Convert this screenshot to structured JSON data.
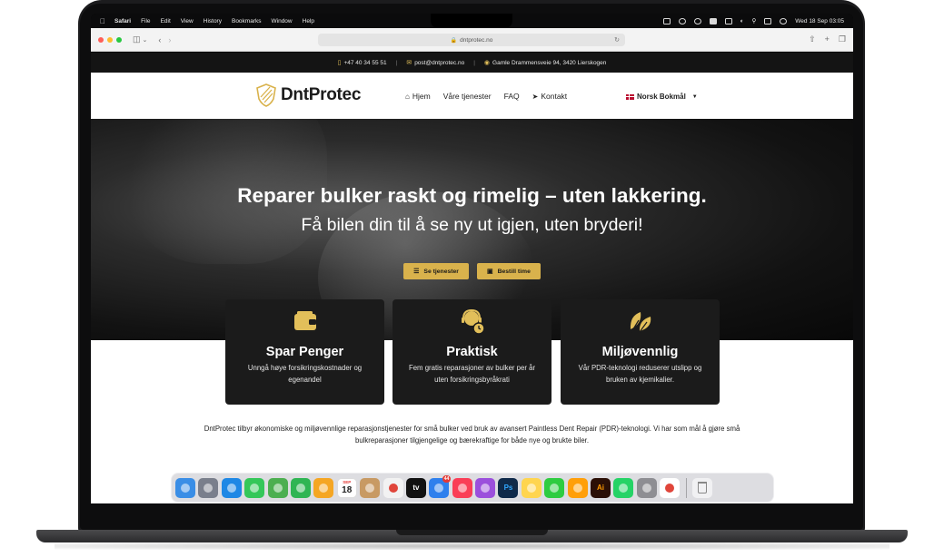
{
  "menubar": {
    "app": "Safari",
    "items": [
      "File",
      "Edit",
      "View",
      "History",
      "Bookmarks",
      "Window",
      "Help"
    ],
    "clock": "Wed 18 Sep  03:05"
  },
  "browser": {
    "url": "dntprotec.no"
  },
  "infobar": {
    "phone": "+47 40 34 55 51",
    "email": "post@dntprotec.no",
    "address": "Gamle Drammensveie 94, 3420 Lierskogen"
  },
  "nav": {
    "logo": "DntProtec",
    "items": [
      "Hjem",
      "Våre tjenester",
      "FAQ",
      "Kontakt"
    ],
    "language": "Norsk Bokmål"
  },
  "hero": {
    "title": "Reparer bulker raskt og rimelig – uten lakkering.",
    "subtitle": "Få bilen din til å se ny ut igjen, uten bryderi!",
    "btn_services": "Se tjenester",
    "btn_book": "Bestill time"
  },
  "cards": [
    {
      "title": "Spar Penger",
      "text": "Unngå høye forsikringskostnader og egenandel",
      "icon": "wallet-icon"
    },
    {
      "title": "Praktisk",
      "text": "Fem gratis reparasjoner av bulker per år uten forsikringsbyråkrati",
      "icon": "support-agent-icon"
    },
    {
      "title": "Miljøvennlig",
      "text": "Vår PDR-teknologi reduserer utslipp og bruken av kjemikalier.",
      "icon": "leaves-icon"
    }
  ],
  "intro": "DntProtec tilbyr økonomiske og miljøvennlige reparasjonstjenester for små bulker ved bruk av avansert Paintless Dent Repair (PDR)-teknologi. Vi har som mål å gjøre små bulkreparasjoner tilgjengelige og bærekraftige for både nye og brukte biler.",
  "dock": {
    "calendar_month": "SEP",
    "calendar_day": "18",
    "mail_badge": "44",
    "apps": [
      {
        "name": "finder",
        "color": "#3a8ee6",
        "label": ""
      },
      {
        "name": "launchpad",
        "color": "#7a7f8c",
        "label": ""
      },
      {
        "name": "safari",
        "color": "#1e88e5",
        "label": ""
      },
      {
        "name": "messages",
        "color": "#34c759",
        "label": ""
      },
      {
        "name": "maps",
        "color": "#4caf50",
        "label": ""
      },
      {
        "name": "facetime",
        "color": "#2fb553",
        "label": ""
      },
      {
        "name": "photos",
        "color": "#f5a623",
        "label": ""
      },
      {
        "name": "calendar",
        "color": "#ffffff",
        "label": ""
      },
      {
        "name": "contacts",
        "color": "#c89a63",
        "label": ""
      },
      {
        "name": "reminders",
        "color": "#f2f2f2",
        "label": ""
      },
      {
        "name": "appletv",
        "color": "#111111",
        "label": "tv"
      },
      {
        "name": "mail",
        "color": "#2f80ed",
        "label": ""
      },
      {
        "name": "music",
        "color": "#fa3e57",
        "label": ""
      },
      {
        "name": "podcasts",
        "color": "#9b4fdc",
        "label": ""
      },
      {
        "name": "photoshop",
        "color": "#0f2a4a",
        "label": "Ps"
      },
      {
        "name": "notes",
        "color": "#ffd54f",
        "label": ""
      },
      {
        "name": "numbers",
        "color": "#2ecc40",
        "label": ""
      },
      {
        "name": "pages",
        "color": "#ff9f0a",
        "label": ""
      },
      {
        "name": "illustrator",
        "color": "#2b0f06",
        "label": "Ai"
      },
      {
        "name": "whatsapp",
        "color": "#25d366",
        "label": ""
      },
      {
        "name": "system-settings",
        "color": "#8e8e93",
        "label": ""
      },
      {
        "name": "chrome",
        "color": "#ffffff",
        "label": ""
      }
    ]
  }
}
